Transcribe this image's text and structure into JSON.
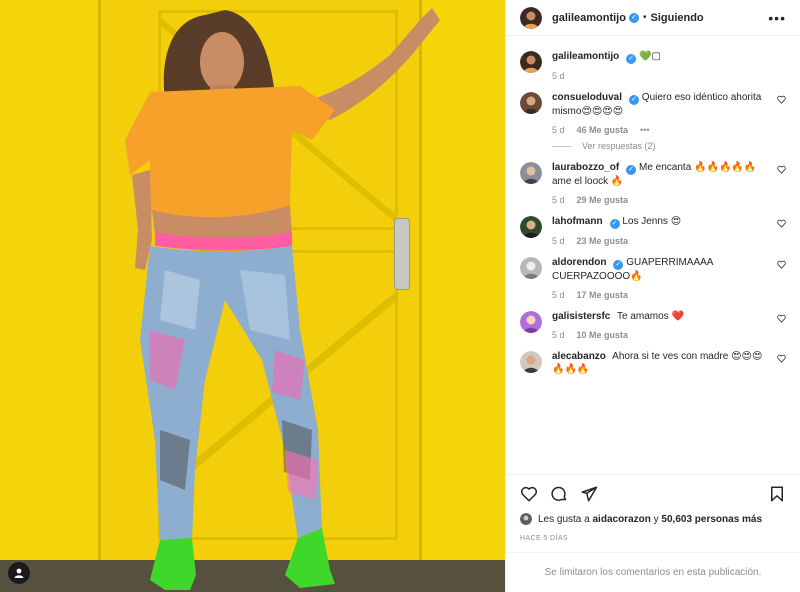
{
  "header": {
    "username": "galileamontijo",
    "separator": "•",
    "follow_state": "Siguiendo",
    "more_icon": "more-horizontal-icon"
  },
  "caption": {
    "username": "galileamontijo",
    "text": "💚▢",
    "age": "5 d"
  },
  "comments": [
    {
      "username": "consueloduval",
      "text": "Quiero eso idéntico ahorita mismo😍😍😍😍",
      "age": "5 d",
      "likes": "46 Me gusta",
      "has_more": true,
      "replies": "Ver respuestas (2)"
    },
    {
      "username": "laurabozzo_of",
      "text": "Me encanta 🔥🔥🔥🔥🔥 ame el loock 🔥",
      "age": "5 d",
      "likes": "29 Me gusta"
    },
    {
      "username": "lahofmann",
      "text": "Los Jenns 😍",
      "age": "5 d",
      "likes": "23 Me gusta"
    },
    {
      "username": "aldorendon",
      "text": "GUAPERRIMAAAA CUERPAZOOOO🔥",
      "age": "5 d",
      "likes": "17 Me gusta"
    },
    {
      "username": "galisistersfc",
      "text": "Te amamos ❤️",
      "age": "5 d",
      "likes": "10 Me gusta"
    },
    {
      "username": "alecabanzo",
      "text": "Ahora si te ves con madre 😍😍😍🔥🔥🔥",
      "age": "",
      "likes": ""
    }
  ],
  "actions": {
    "liked_by_prefix": "Les gusta a",
    "liked_by_user": "aidacorazon",
    "liked_by_mid": "y",
    "liked_by_count": "50,603 personas más",
    "timestamp": "HACE 5 DÍAS",
    "comments_disabled": "Se limitaron los comentarios en esta publicación."
  },
  "colors": {
    "verified": "#3897f0",
    "muted": "#8e8e8e",
    "text": "#262626",
    "wall": "#f4d308"
  }
}
